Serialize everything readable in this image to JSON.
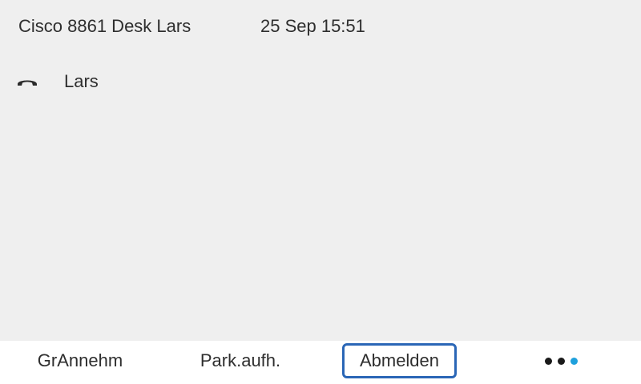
{
  "header": {
    "device_title": "Cisco 8861 Desk Lars",
    "datetime": "25 Sep 15:51"
  },
  "line": {
    "icon": "handset-icon",
    "label": "Lars"
  },
  "softkeys": {
    "items": [
      {
        "label": "GrAnnehm"
      },
      {
        "label": "Park.aufh."
      },
      {
        "label": "Abmelden",
        "selected": true
      }
    ],
    "more": {
      "icon": "more-dots-icon",
      "active_dot_color": "#1ea0dc"
    }
  },
  "colors": {
    "background": "#efefef",
    "softkey_bar": "#ffffff",
    "focus_border": "#2a66b6"
  }
}
